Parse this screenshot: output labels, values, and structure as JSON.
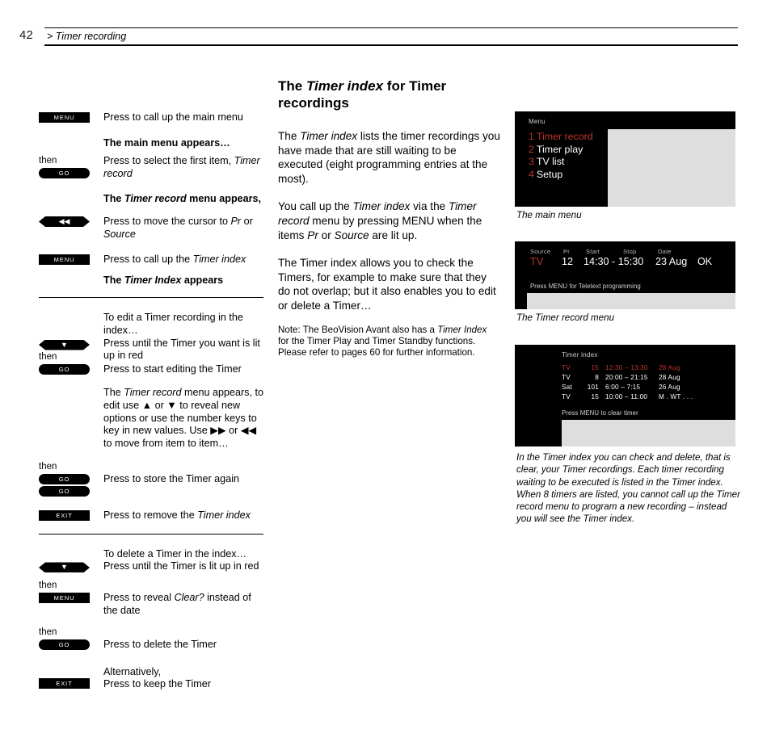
{
  "header": {
    "page_number": "42",
    "breadcrumb": "> Timer recording"
  },
  "main": {
    "title_pre": "The ",
    "title_em": "Timer index",
    "title_post": " for Timer recordings",
    "paragraphs": [
      "The Timer index lists the timer recordings you have made that are still waiting to be executed (eight programming entries at the most).",
      "You call up the Timer index via the Timer record menu by pressing MENU when the items Pr or Source are lit up.",
      "The Timer index allows you to check the Timers, for example to make sure that they do not overlap; but it also enables you to edit or delete a Timer…"
    ],
    "note": "Note: The BeoVision Avant also has a Timer Index for the Timer Play and Timer Standby functions. Please refer to pages 60 for further information."
  },
  "steps": {
    "then_label": "then",
    "group1": [
      {
        "key": "MENU",
        "key_type": "rect",
        "text": "Press to call up the main menu"
      },
      {
        "key": "",
        "key_type": "none",
        "text": "The main menu appears…",
        "bold": true
      },
      {
        "key": "GO",
        "key_type": "pill",
        "text": "Press to select the first item, Timer record",
        "then": true
      },
      {
        "key": "",
        "key_type": "none",
        "text": "The Timer record menu appears,",
        "bold": true
      },
      {
        "key": "◀◀",
        "key_type": "hex",
        "text": "Press to move the cursor to Pr or Source"
      },
      {
        "key": "MENU",
        "key_type": "rect",
        "text": "Press to call up the Timer index"
      },
      {
        "key": "",
        "key_type": "none",
        "text": "The Timer Index appears",
        "bold": true
      }
    ],
    "group2": {
      "intro": "To edit a Timer recording in the index…",
      "arrow_text": "Press until the Timer you want is lit up in red",
      "go_text": "Press to start editing the Timer",
      "body": "The Timer record menu appears, to edit use ▲ or ▼ to reveal new options or use the number keys to key in new values. Use ▶▶ or ◀◀ to move from item to item…",
      "store_text": "Press to store the Timer again",
      "exit_text": "Press to remove the Timer index",
      "arrow_key": "▼",
      "go_key": "GO",
      "exit_key": "EXIT"
    },
    "group3": {
      "intro": "To delete a Timer in the index…",
      "arrow_text": "Press until the Timer is lit up in red",
      "menu_text": "Press to reveal Clear? instead of the date",
      "go_text": "Press to delete the Timer",
      "alt_label": "Alternatively,",
      "exit_text": "Press to keep the Timer",
      "arrow_key": "▼",
      "menu_key": "MENU",
      "go_key": "GO",
      "exit_key": "EXIT"
    }
  },
  "screens": {
    "main_menu": {
      "title": "Menu",
      "items": [
        {
          "num": "1",
          "label": "Timer record",
          "selected": true
        },
        {
          "num": "2",
          "label": "Timer play",
          "selected": false
        },
        {
          "num": "3",
          "label": "TV list",
          "selected": false
        },
        {
          "num": "4",
          "label": "Setup",
          "selected": false
        }
      ],
      "caption": "The main menu"
    },
    "timer_record": {
      "headers": {
        "source": "Source",
        "pr": "Pr",
        "start": "Start",
        "stop": "Stop",
        "date": "Date"
      },
      "values": {
        "source": "TV",
        "pr": "12",
        "time": "14:30 - 15:30",
        "date": "23 Aug",
        "ok": "OK"
      },
      "hint": "Press MENU for Teletext programming",
      "caption": "The Timer record menu"
    },
    "timer_index": {
      "title": "Timer index",
      "rows": [
        {
          "source": "TV",
          "pr": "15",
          "time": "12:30 – 13:30",
          "date": "28 Aug",
          "highlight": true
        },
        {
          "source": "TV",
          "pr": "8",
          "time": "20:00 – 21:15",
          "date": "28 Aug",
          "highlight": false
        },
        {
          "source": "Sat",
          "pr": "101",
          "time": "6:00 –  7:15",
          "date": "26 Aug",
          "highlight": false
        },
        {
          "source": "TV",
          "pr": "15",
          "time": "10:00 – 11:00",
          "date": "M . WT . . .",
          "highlight": false
        }
      ],
      "hint": "Press MENU to clear timer",
      "caption": "In the Timer index you can check and delete, that is clear, your Timer recordings. Each timer recording waiting to be executed is listed in the Timer index. When 8 timers are listed, you cannot call up the Timer record menu to program a new recording – instead you will see the Timer index."
    }
  },
  "colors": {
    "accent_red": "#c0342a",
    "screen_bg": "#000000",
    "panel_gray": "#dedede"
  }
}
